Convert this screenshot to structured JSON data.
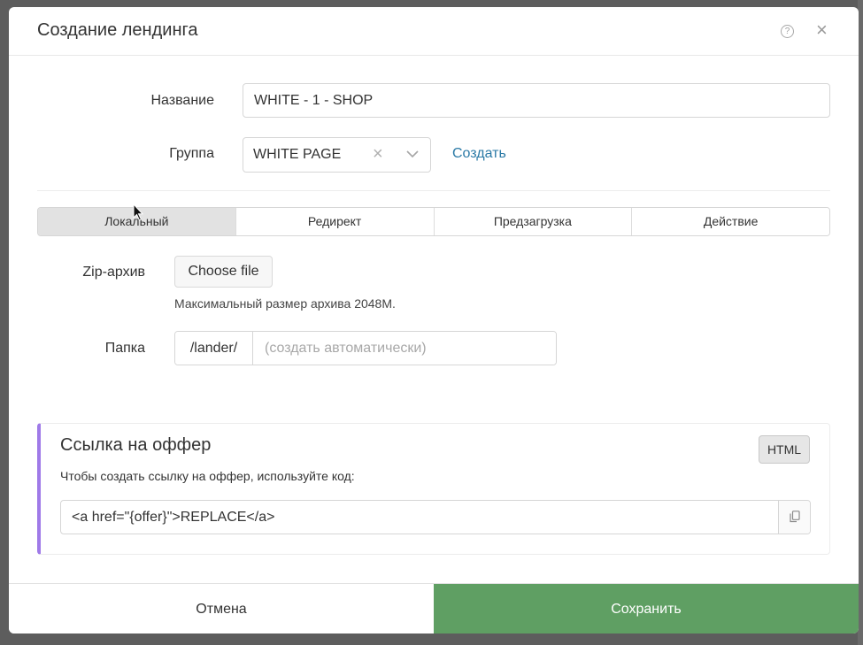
{
  "modal": {
    "title": "Создание лендинга",
    "help_icon_glyph": "?",
    "close_icon_glyph": "×"
  },
  "form": {
    "name": {
      "label": "Название",
      "value": "WHITE - 1 - SHOP"
    },
    "group": {
      "label": "Группа",
      "selected": "WHITE PAGE",
      "clear_glyph": "×",
      "create_link": "Создать"
    }
  },
  "tabs": [
    {
      "label": "Локальный",
      "active": true
    },
    {
      "label": "Редирект",
      "active": false
    },
    {
      "label": "Предзагрузка",
      "active": false
    },
    {
      "label": "Действие",
      "active": false
    }
  ],
  "local": {
    "zip": {
      "label": "Zip-архив",
      "button": "Choose file",
      "help": "Максимальный размер архива 2048M."
    },
    "folder": {
      "label": "Папка",
      "prefix": "/lander/",
      "placeholder": "(создать автоматически)"
    }
  },
  "offer": {
    "title": "Ссылка на оффер",
    "badge": "HTML",
    "description": "Чтобы создать ссылку на оффер, используйте код:",
    "code": "<a href=\"{offer}\">REPLACE</a>"
  },
  "footer": {
    "cancel": "Отмена",
    "save": "Сохранить"
  },
  "icons": {
    "help": "help-icon",
    "close": "close-icon",
    "clear": "clear-icon",
    "chevron": "chevron-down-icon",
    "copy": "copy-icon",
    "cursor": "mouse-cursor-icon"
  },
  "colors": {
    "accent_link": "#2b7aa6",
    "save_button": "#5f9f63",
    "offer_accent": "#9f7ae8",
    "active_tab": "#e2e2e2"
  }
}
